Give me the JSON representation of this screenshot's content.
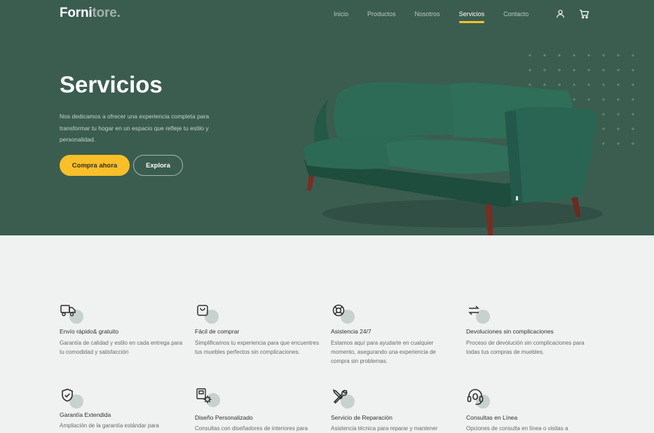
{
  "brand": {
    "name_main": "Forni",
    "name_rest": "tore."
  },
  "nav": {
    "items": [
      "Inicio",
      "Productos",
      "Nosotros",
      "Servicios",
      "Contacto"
    ],
    "active": "Servicios",
    "user_icon": "user-icon",
    "cart_icon": "cart-icon"
  },
  "hero": {
    "title": "Servicios",
    "text": "Nos dedicamos a ofrecer una experiencia completa para transformar tu hogar en un espacio que refleje tu estilo y personalidad.",
    "primary_button": "Compra ahora",
    "secondary_button": "Explora",
    "image": "green-velvet-sofa"
  },
  "features": [
    {
      "icon": "truck-icon",
      "title": "Envío rápido& gratuito",
      "text": "Garantía de calidad y estilo en cada entrega para tu comodidad y satisfacción"
    },
    {
      "icon": "shopping-bag-icon",
      "title": "Fácil de comprar",
      "text": "Simplificamos tu experiencia para que encuentres tus muebles perfectos sin complicaciones."
    },
    {
      "icon": "lifebuoy-icon",
      "title": "Asistencia 24/7",
      "text": "Estamos aquí para ayudarte en cualquier momento, asegurando una experiencia de compra sin problemas."
    },
    {
      "icon": "return-arrows-icon",
      "title": "Devoluciones sin complicaciones",
      "text": "Proceso de devolución sin complicaciones para todas tus compras de muebles."
    },
    {
      "icon": "shield-check-icon",
      "title": "Garantía Extendida",
      "text": "Ampliación de la garantía estándar para"
    },
    {
      "icon": "design-gear-icon",
      "title": "Diseño Personalizado",
      "text": "Consultas con diseñadores de interiores para"
    },
    {
      "icon": "tools-icon",
      "title": "Servicio de Reparación",
      "text": "Asistencia técnica para reparar y mantener"
    },
    {
      "icon": "headset-icon",
      "title": "Consultas en Línea",
      "text": "Opciones de consulta en línea o visitas a"
    }
  ],
  "colors": {
    "hero_bg": "#3b5d50",
    "accent": "#f9bf29",
    "page_bg": "#eff2f1",
    "text": "#2f2f2f"
  }
}
